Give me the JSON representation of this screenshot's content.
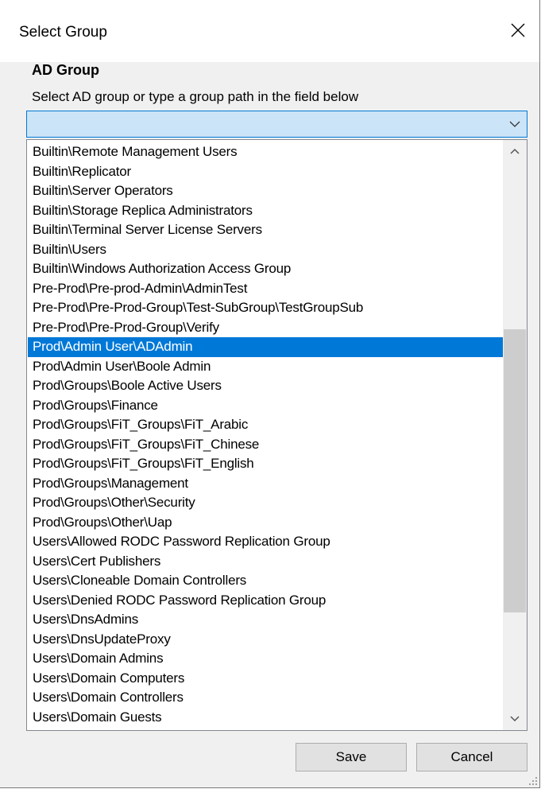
{
  "window": {
    "title": "Select Group"
  },
  "section": {
    "header": "AD Group",
    "instructions": "Select AD group or type a group path in the field below"
  },
  "combo": {
    "value": ""
  },
  "groups": {
    "items": [
      "Builtin\\Remote Management Users",
      "Builtin\\Replicator",
      "Builtin\\Server Operators",
      "Builtin\\Storage Replica Administrators",
      "Builtin\\Terminal Server License Servers",
      "Builtin\\Users",
      "Builtin\\Windows Authorization Access Group",
      "Pre-Prod\\Pre-prod-Admin\\AdminTest",
      "Pre-Prod\\Pre-Prod-Group\\Test-SubGroup\\TestGroupSub",
      "Pre-Prod\\Pre-Prod-Group\\Verify",
      "Prod\\Admin User\\ADAdmin",
      "Prod\\Admin User\\Boole Admin",
      "Prod\\Groups\\Boole Active Users",
      "Prod\\Groups\\Finance",
      "Prod\\Groups\\FiT_Groups\\FiT_Arabic",
      "Prod\\Groups\\FiT_Groups\\FiT_Chinese",
      "Prod\\Groups\\FiT_Groups\\FiT_English",
      "Prod\\Groups\\Management",
      "Prod\\Groups\\Other\\Security",
      "Prod\\Groups\\Other\\Uap",
      "Users\\Allowed RODC Password Replication Group",
      "Users\\Cert Publishers",
      "Users\\Cloneable Domain Controllers",
      "Users\\Denied RODC Password Replication Group",
      "Users\\DnsAdmins",
      "Users\\DnsUpdateProxy",
      "Users\\Domain Admins",
      "Users\\Domain Computers",
      "Users\\Domain Controllers",
      "Users\\Domain Guests"
    ],
    "selected_index": 10
  },
  "buttons": {
    "save": "Save",
    "cancel": "Cancel"
  },
  "icons": {
    "close": "close-icon",
    "dropdown": "chevron-down-icon",
    "scroll_up": "chevron-up-icon",
    "scroll_down": "chevron-down-icon"
  },
  "colors": {
    "selection": "#0078d7",
    "combo_bg": "#cce4f7"
  }
}
